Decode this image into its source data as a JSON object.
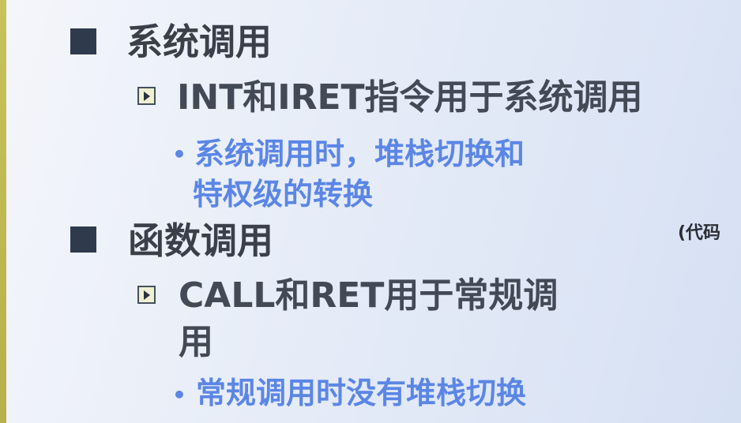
{
  "slide": {
    "items": [
      {
        "title": "系统调用",
        "sub": {
          "title": "INT和IRET指令用于系统调用",
          "detail_line1": "系统调用时，堆栈切换和",
          "detail_line2": "特权级的转换"
        }
      },
      {
        "title": "函数调用",
        "sub": {
          "title_line1": "CALL和RET用于常规调",
          "title_line2": "用",
          "detail_line1": "常规调用时没有堆栈切换"
        }
      }
    ],
    "side_note": "(代码"
  },
  "colors": {
    "heading": "#3a3f4a",
    "subheading": "#444a55",
    "detail": "#5b86e6",
    "left_bar": "#c8c25a"
  },
  "icons": {
    "level1": "square-bullet-icon",
    "level2": "play-square-bullet-icon",
    "level3": "dot-bullet-icon"
  }
}
